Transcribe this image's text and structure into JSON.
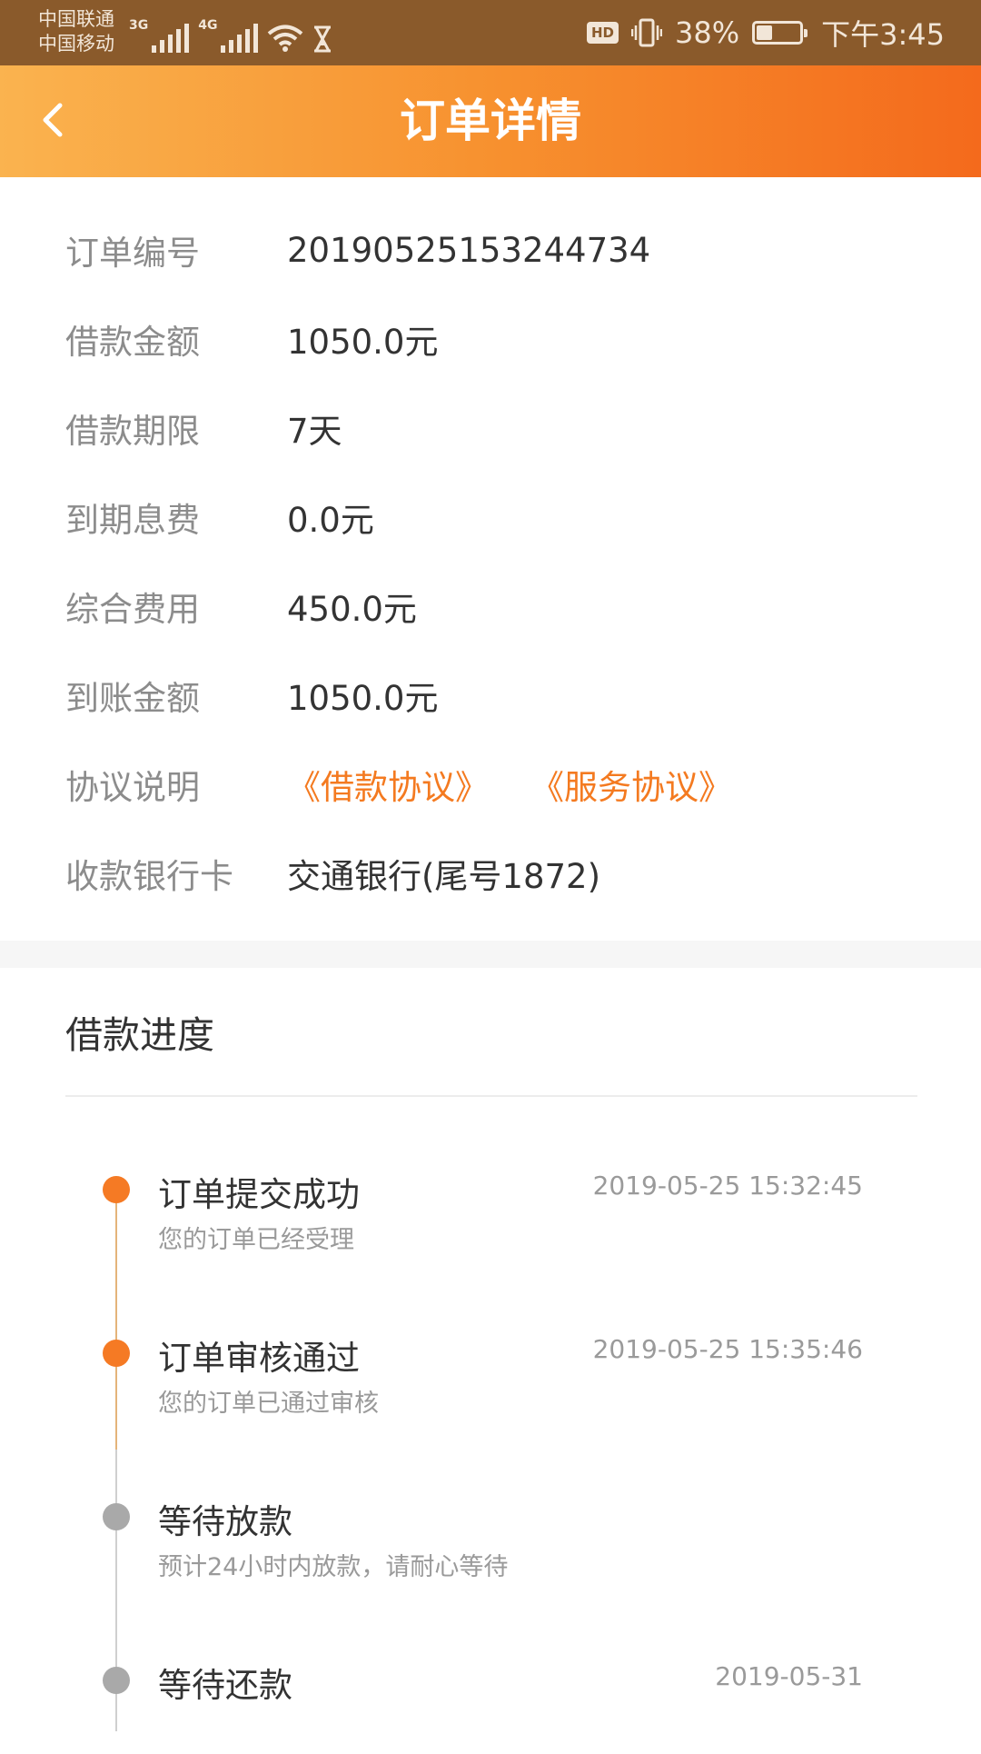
{
  "status_bar": {
    "carrier_1": "中国联通",
    "carrier_2": "中国移动",
    "network_1": "3G",
    "network_2": "4G",
    "hd": "HD",
    "battery_percent": "38%",
    "battery_level": 0.38,
    "time": "下午3:45"
  },
  "header": {
    "title": "订单详情",
    "back_icon": "chevron-left-icon"
  },
  "order": {
    "rows": [
      {
        "label": "订单编号",
        "value": "20190525153244734"
      },
      {
        "label": "借款金额",
        "value": "1050.0元"
      },
      {
        "label": "借款期限",
        "value": "7天"
      },
      {
        "label": "到期息费",
        "value": "0.0元"
      },
      {
        "label": "综合费用",
        "value": "450.0元"
      },
      {
        "label": "到账金额",
        "value": "1050.0元"
      }
    ],
    "agreement": {
      "label": "协议说明",
      "loan_agreement": "《借款协议》",
      "service_agreement": "《服务协议》"
    },
    "bank_card": {
      "label": "收款银行卡",
      "value": "交通银行(尾号1872)"
    }
  },
  "progress": {
    "title": "借款进度",
    "steps": [
      {
        "title": "订单提交成功",
        "desc": "您的订单已经受理",
        "time": "2019-05-25 15:32:45",
        "status": "done"
      },
      {
        "title": "订单审核通过",
        "desc": "您的订单已通过审核",
        "time": "2019-05-25 15:35:46",
        "status": "done"
      },
      {
        "title": "等待放款",
        "desc": "预计24小时内放款，请耐心等待",
        "time": "",
        "status": "pending"
      },
      {
        "title": "等待还款",
        "desc": "",
        "time": "2019-05-31",
        "status": "pending"
      }
    ]
  },
  "colors": {
    "accent": "#f47a20",
    "header_start": "#fab34f",
    "header_end": "#f46a1c",
    "status_bar": "#8a5a2b",
    "done_dot": "#f57a24",
    "pending_dot": "#a9a9a9"
  }
}
